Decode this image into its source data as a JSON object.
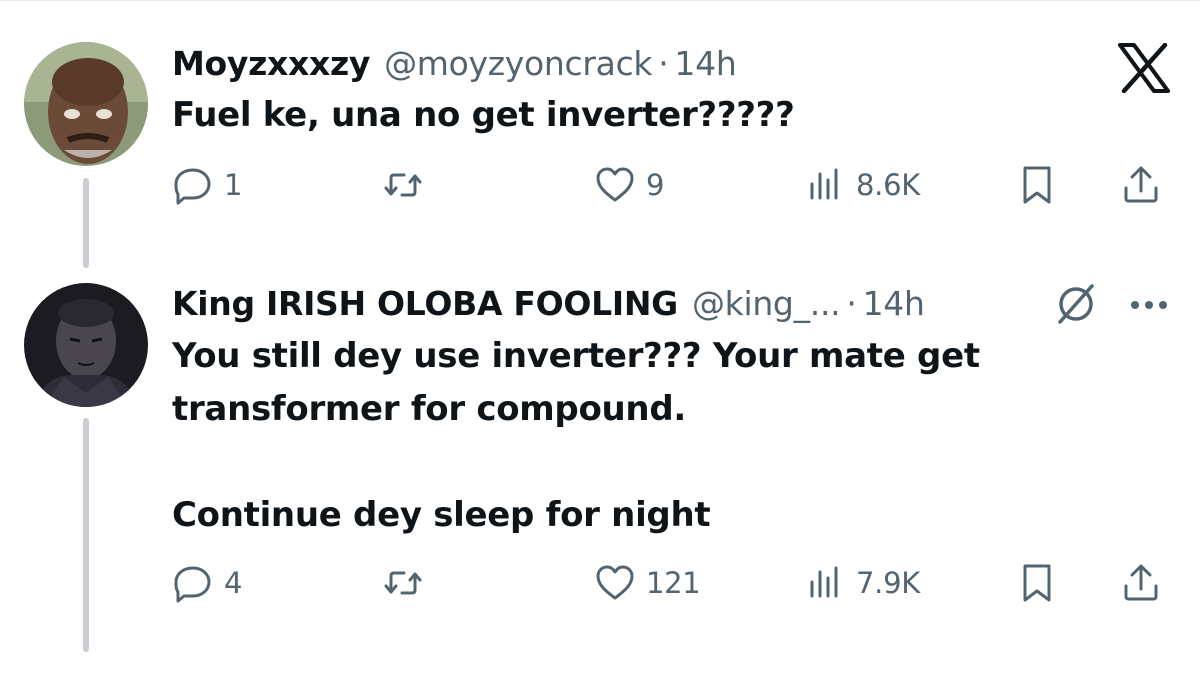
{
  "tweets": [
    {
      "name": "Moyzxxxzy",
      "handle": "@moyzyoncrack",
      "separator": "·",
      "time": "14h",
      "text_lines": [
        "Fuel ke, una no get inverter?????"
      ],
      "replies": "1",
      "likes": "9",
      "views": "8.6K"
    },
    {
      "name": "King IRISH OLOBA FOOLING",
      "handle": "@king_...",
      "separator": "·",
      "time": "14h",
      "text_lines": [
        "You still dey use inverter??? Your mate get",
        "transformer for compound.",
        "",
        "Continue dey sleep for night"
      ],
      "replies": "4",
      "likes": "121",
      "views": "7.9K"
    }
  ],
  "icons": {
    "brand": "x-logo-icon",
    "reply": "reply-bubble-icon",
    "repost": "repost-icon",
    "like": "heart-icon",
    "views": "views-bar-icon",
    "bookmark": "bookmark-icon",
    "share": "share-icon",
    "grok": "grok-icon",
    "more": "more-dots-icon"
  },
  "colors": {
    "text": "#0f1419",
    "secondary": "#536471",
    "thread_line": "#c9cdd1",
    "background": "#ffffff"
  }
}
